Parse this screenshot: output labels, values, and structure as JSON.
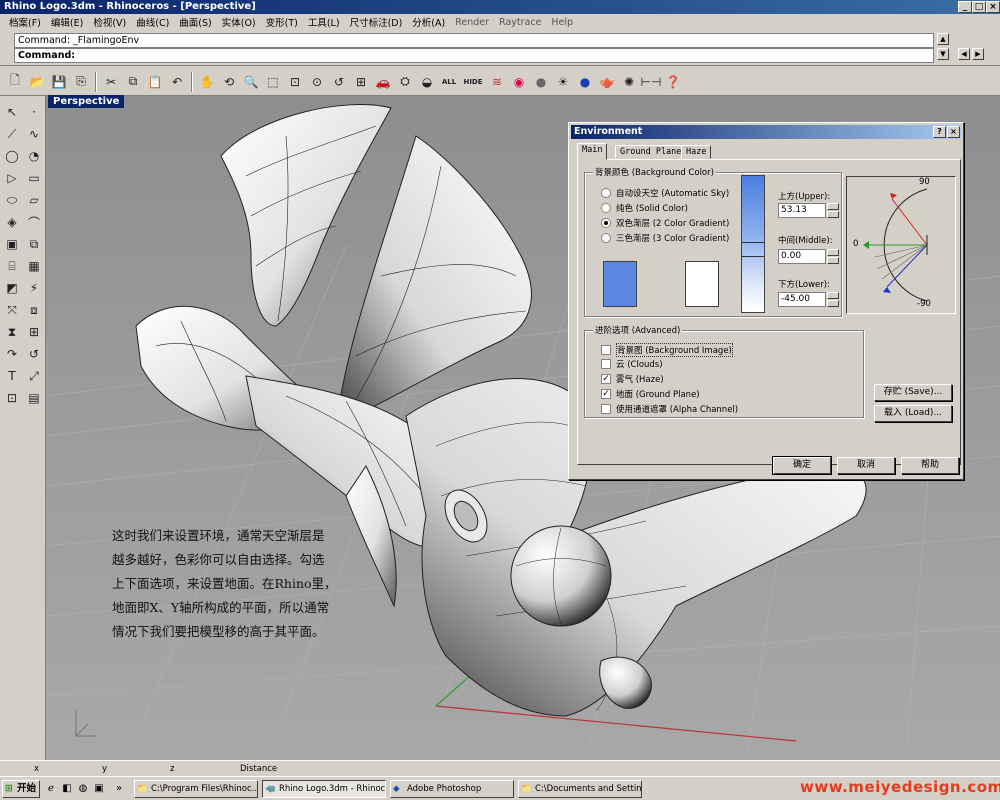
{
  "window": {
    "title": "Rhino Logo.3dm - Rhinoceros - [Perspective]"
  },
  "menu": [
    "档案(F)",
    "编辑(E)",
    "检视(V)",
    "曲线(C)",
    "曲面(S)",
    "实体(O)",
    "变形(T)",
    "工具(L)",
    "尺寸标注(D)",
    "分析(A)",
    "Render",
    "Raytrace",
    "Help"
  ],
  "command": {
    "history": "Command: _FlamingoEnv",
    "prompt": "Command:"
  },
  "toolbar": {
    "all_label": "ALL",
    "hide_label": "HIDE"
  },
  "viewport": {
    "label": "Perspective"
  },
  "overlay": {
    "lines": [
      "这时我们来设置环境，通常天空渐层是",
      "越多越好，色彩你可以自由选择。勾选",
      "上下面选项，来设置地面。在Rhino里，",
      "地面即X、Y轴所构成的平面，所以通常",
      "情况下我们要把模型移的高于其平面。"
    ]
  },
  "dialog": {
    "title": "Environment",
    "tabs": [
      "Main",
      "Ground Plane",
      "Haze"
    ],
    "bg_group": "背景颜色 (Background Color)",
    "bg_options": [
      {
        "label": "自动设天空 (Automatic Sky)",
        "selected": false
      },
      {
        "label": "纯色 (Solid Color)",
        "selected": false
      },
      {
        "label": "双色渐层 (2 Color Gradient)",
        "selected": true
      },
      {
        "label": "三色渐层 (3 Color Gradient)",
        "selected": false
      }
    ],
    "upper_label": "上方(Upper):",
    "upper_value": "53.13",
    "middle_label": "中间(Middle):",
    "middle_value": "0.00",
    "lower_label": "下方(Lower):",
    "lower_value": "-45.00",
    "dial_top": "90",
    "dial_mid": "0",
    "dial_bottom": "-90",
    "adv_group": "进阶选项 (Advanced)",
    "adv_options": [
      {
        "label": "背景图 (Background Image)",
        "checked": false
      },
      {
        "label": "云 (Clouds)",
        "checked": false
      },
      {
        "label": "雾气 (Haze)",
        "checked": true
      },
      {
        "label": "地面 (Ground Plane)",
        "checked": true
      },
      {
        "label": "使用通道遮罩 (Alpha Channel)",
        "checked": false
      }
    ],
    "save_label": "存贮 (Save)...",
    "load_label": "载入 (Load)...",
    "ok_label": "确定",
    "cancel_label": "取消",
    "help_label": "帮助",
    "colors": {
      "top_swatch": "#5b87e0",
      "bottom_swatch": "#ffffff"
    }
  },
  "status": {
    "x": "x",
    "y": "y",
    "z": "z",
    "distance": "Distance"
  },
  "taskbar": {
    "start": "开始",
    "tasks": [
      "C:\\Program Files\\Rhinoc...",
      "Rhino Logo.3dm - Rhinoc...",
      "Adobe Photoshop",
      "C:\\Documents and Settin..."
    ],
    "watermark": "www.meiyedesign.com"
  }
}
